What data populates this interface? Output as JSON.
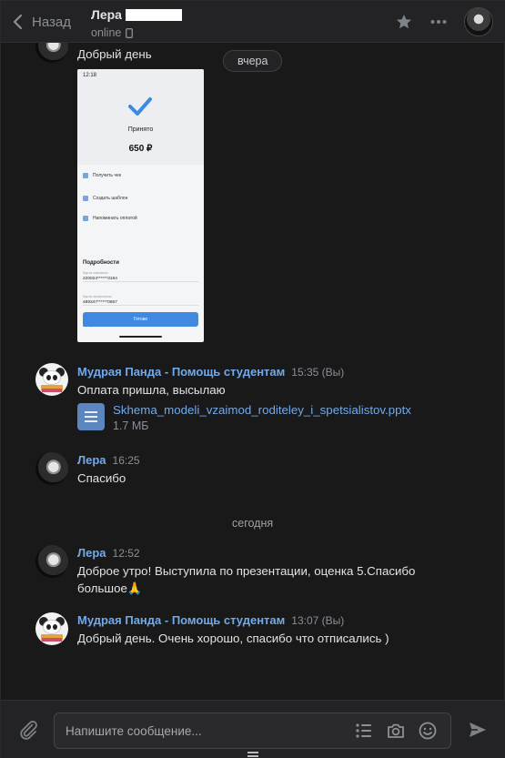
{
  "header": {
    "back_label": "Назад",
    "peer_name": "Лера",
    "peer_status": "online"
  },
  "chat": {
    "date_yesterday": "вчера",
    "date_today": "сегодня",
    "first_text": "Добрый день",
    "screenshot": {
      "time": "12:18",
      "title": "Принято",
      "amount": "650 ₽",
      "actions": [
        "Получить чек",
        "Создать шаблон",
        "Напоминать оплатой"
      ],
      "section": "Подробности",
      "fields": [
        {
          "label": "Карта списания",
          "value": "220024******3194"
        },
        {
          "label": "Карта зачисления",
          "value": "489347******0667"
        },
        {
          "label": "Сумма в рублях",
          "value": "650,00 ₽"
        }
      ],
      "button": "Готово"
    },
    "messages": [
      {
        "author": "Мудрая Панда - Помощь студентам",
        "time": "15:35 (Вы)",
        "text": "Оплата пришла, высылаю",
        "file": {
          "name": "Skhema_modeli_vzaimod_roditeley_i_spetsialistov.pptx",
          "size": "1.7 МБ"
        }
      },
      {
        "author": "Лера",
        "time": "16:25",
        "text": "Спасибо"
      },
      {
        "author": "Лера",
        "time": "12:52",
        "text": "Доброе утро! Выступила по презентации, оценка 5.Спасибо",
        "text2": "большое🙏"
      },
      {
        "author": "Мудрая Панда - Помощь студентам",
        "time": "13:07 (Вы)",
        "text": "Добрый день. Очень хорошо, спасибо что отписались )"
      }
    ]
  },
  "composer": {
    "placeholder": "Напишите сообщение..."
  }
}
